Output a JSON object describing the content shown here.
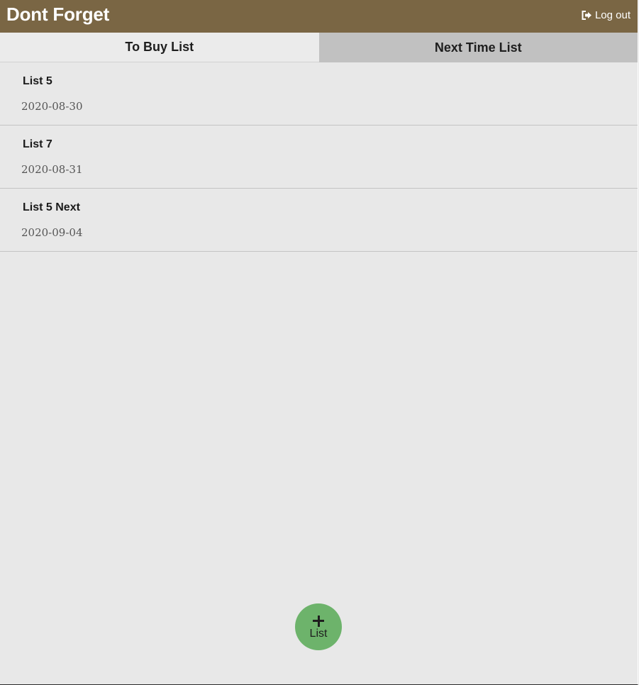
{
  "header": {
    "title": "Dont Forget",
    "logout_label": "Log out"
  },
  "tabs": [
    {
      "label": "To Buy List",
      "active": true
    },
    {
      "label": "Next Time List",
      "active": false
    }
  ],
  "lists": [
    {
      "name": "List 5",
      "date": "2020-08-30"
    },
    {
      "name": "List 7",
      "date": "2020-08-31"
    },
    {
      "name": "List 5 Next",
      "date": "2020-09-04"
    }
  ],
  "fab": {
    "icon": "plus-icon",
    "label": "List"
  },
  "colors": {
    "header_bg": "#7a6644",
    "fab_bg": "#6db36b",
    "active_tab_bg": "#ebebeb",
    "inactive_tab_bg": "#c1c1c1"
  }
}
